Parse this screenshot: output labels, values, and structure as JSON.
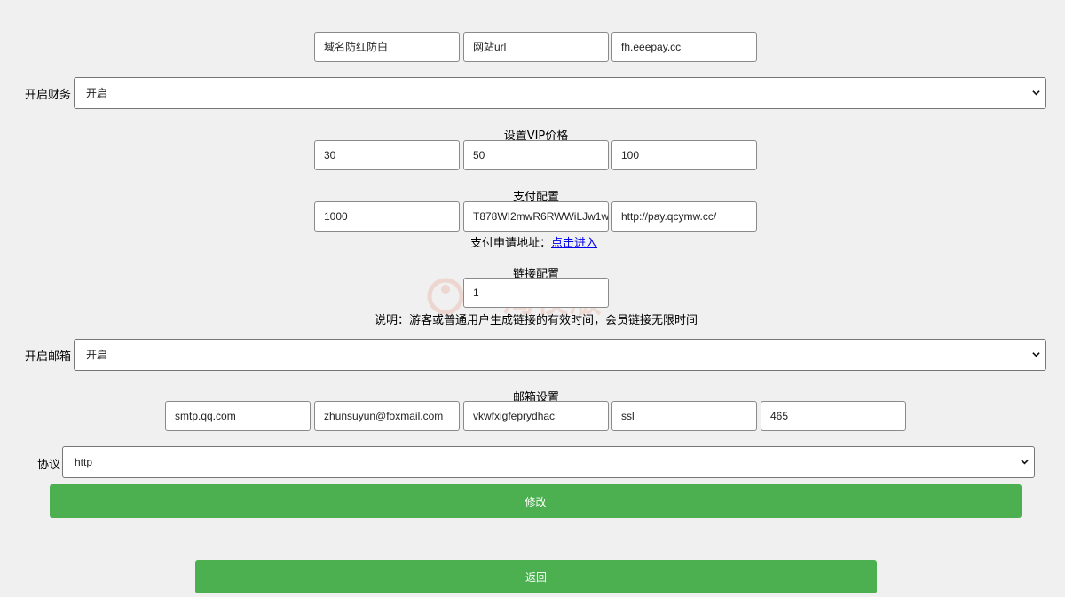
{
  "domain_row": {
    "fields": [
      {
        "value": "域名防红防白"
      },
      {
        "value": "网站url"
      },
      {
        "value": "fh.eeepay.cc"
      }
    ]
  },
  "finance": {
    "label": "开启财务",
    "selected": "开启"
  },
  "vip": {
    "heading": "设置VIP价格",
    "fields": [
      {
        "value": "30"
      },
      {
        "value": "50"
      },
      {
        "value": "100"
      }
    ]
  },
  "payment": {
    "heading": "支付配置",
    "fields": [
      {
        "value": "1000"
      },
      {
        "value": "T878WI2mwR6RWWiLJw1w"
      },
      {
        "value": "http://pay.qcymw.cc/"
      }
    ],
    "apply_prefix": "支付申请地址：",
    "apply_link": "点击进入"
  },
  "link_config": {
    "heading": "链接配置",
    "value": "1",
    "note": "说明：游客或普通用户生成链接的有效时间，会员链接无限时间"
  },
  "mail_toggle": {
    "label": "开启邮箱",
    "selected": "开启"
  },
  "mail": {
    "heading": "邮箱设置",
    "fields": [
      {
        "value": "smtp.qq.com"
      },
      {
        "value": "zhunsuyun@foxmail.com"
      },
      {
        "value": "vkwfxigfeprydhac"
      },
      {
        "value": "ssl"
      },
      {
        "value": "465"
      }
    ]
  },
  "protocol": {
    "label": "协议",
    "selected": "http"
  },
  "buttons": {
    "modify": "修改",
    "back": "返回"
  },
  "watermark": {
    "text": "一淘模版"
  },
  "colors": {
    "button_green": "#4caf50",
    "background": "#f0f0f0",
    "link_blue": "#0000ee"
  }
}
